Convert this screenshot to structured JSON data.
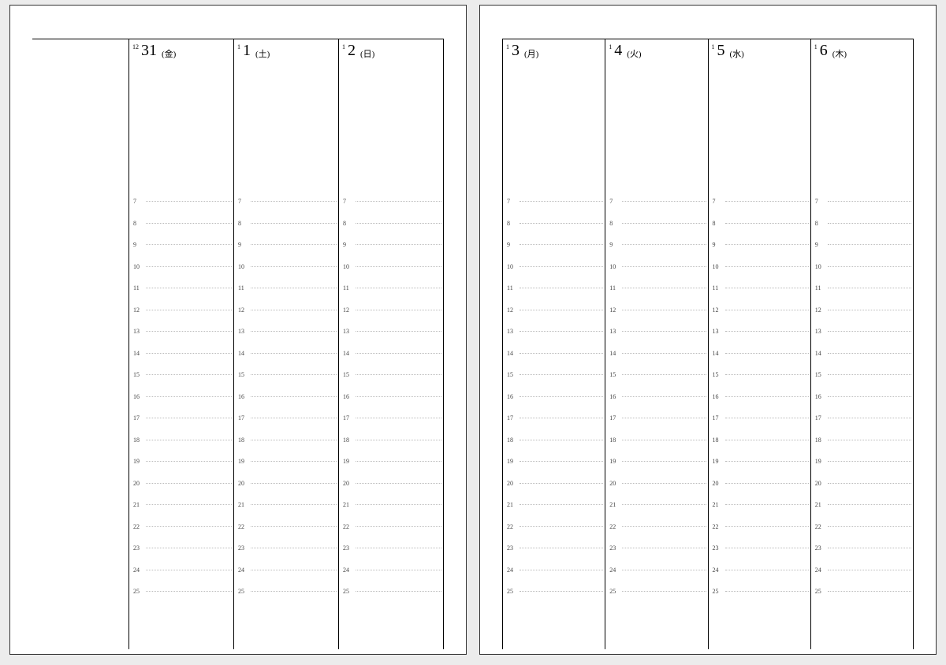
{
  "hours": [
    "7",
    "8",
    "9",
    "10",
    "11",
    "12",
    "13",
    "14",
    "15",
    "16",
    "17",
    "18",
    "19",
    "20",
    "21",
    "22",
    "23",
    "24",
    "25"
  ],
  "pages": [
    {
      "side": "left",
      "days": [
        {
          "month": "12",
          "day": "31",
          "weekday": "(金)"
        },
        {
          "month": "1",
          "day": "1",
          "weekday": "(土)"
        },
        {
          "month": "1",
          "day": "2",
          "weekday": "(日)"
        }
      ]
    },
    {
      "side": "right",
      "days": [
        {
          "month": "1",
          "day": "3",
          "weekday": "(月)"
        },
        {
          "month": "1",
          "day": "4",
          "weekday": "(火)"
        },
        {
          "month": "1",
          "day": "5",
          "weekday": "(水)"
        },
        {
          "month": "1",
          "day": "6",
          "weekday": "(木)"
        }
      ]
    }
  ]
}
